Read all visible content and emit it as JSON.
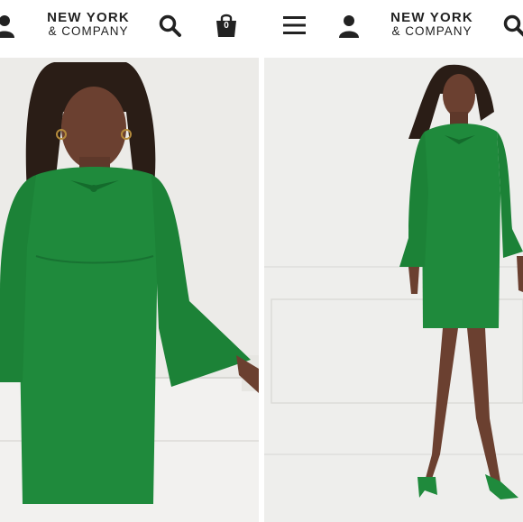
{
  "left_screen": {
    "logo": {
      "line1": "NEW YORK",
      "line2": "& COMPANY"
    },
    "bag": {
      "count": "0"
    },
    "icons": [
      "account-icon",
      "search-icon",
      "shopping-bag-icon"
    ],
    "photo": {
      "subject": "product-photo-closeup"
    }
  },
  "right_screen": {
    "logo": {
      "line1": "NEW YORK",
      "line2": "& COMPANY"
    },
    "icons": [
      "hamburger-menu-icon",
      "account-icon",
      "search-icon"
    ],
    "photo": {
      "subject": "product-photo-full-length"
    }
  },
  "colors": {
    "dress_green": "#1f8a3c",
    "background": "#ededeb",
    "skin": "#6b4030",
    "text": "#222222"
  }
}
